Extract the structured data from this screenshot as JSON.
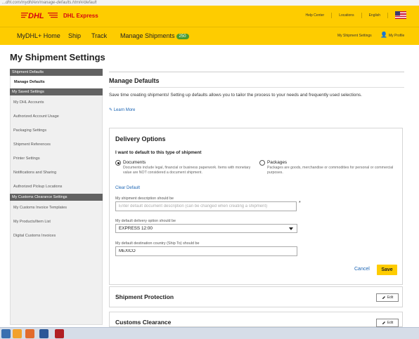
{
  "browser": {
    "url": "...dhl.com/mydhl/en/manage-defaults.html#/default"
  },
  "header": {
    "brand": "DHL Express",
    "utility_links": [
      "Help Center",
      "Locations",
      "English"
    ]
  },
  "nav": {
    "items": [
      "MyDHL+ Home",
      "Ship",
      "Track",
      "Manage Shipments"
    ],
    "shipments_badge": "250",
    "right_links": [
      "My Shipment Settings",
      "My Profile"
    ]
  },
  "page": {
    "title": "My Shipment Settings"
  },
  "sidebar": {
    "sections": [
      {
        "header": "Shipment Defaults",
        "items": [
          "Manage Defaults"
        ]
      },
      {
        "header": "My Saved Settings",
        "items": [
          "My DHL Accounts",
          "Authorized Account Usage",
          "Packaging Settings",
          "Shipment References",
          "Printer Settings",
          "Notifications and Sharing",
          "Authorized Pickup Locations"
        ]
      },
      {
        "header": "My Customs Clearance Settings",
        "items": [
          "My Customs Invoice Templates",
          "My Products/Item List",
          "Digital Customs Invoices"
        ]
      }
    ]
  },
  "main": {
    "title": "Manage Defaults",
    "intro": "Save time creating shipments! Setting up defaults allows you to tailor the process to your needs and frequently used selections.",
    "learn_more": "Learn More"
  },
  "delivery": {
    "title": "Delivery Options",
    "question": "I want to default to this type of shipment",
    "options": [
      {
        "title": "Documents",
        "desc": "Documents include legal, financial or business paperwork.  Items with monetary value are NOT considered a document shipment.",
        "selected": true
      },
      {
        "title": "Packages",
        "desc": "Packages are goods, merchandise or commodities for personal or commercial purposes.",
        "selected": false
      }
    ],
    "clear_default": "Clear Default",
    "desc_label": "My shipment description should be",
    "desc_placeholder": "Enter default document description (can be changed when creating a shipment)",
    "delivery_label": "My default delivery option should be",
    "delivery_value": "EXPRESS 12:00",
    "country_label": "My default destination country (Ship To) should be",
    "country_value": "MEXICO",
    "required_mark": "*",
    "cancel": "Cancel",
    "save": "Save"
  },
  "sections": [
    {
      "title": "Shipment Protection",
      "edit": "Edit"
    },
    {
      "title": "Customs Clearance",
      "edit": "Edit"
    }
  ]
}
